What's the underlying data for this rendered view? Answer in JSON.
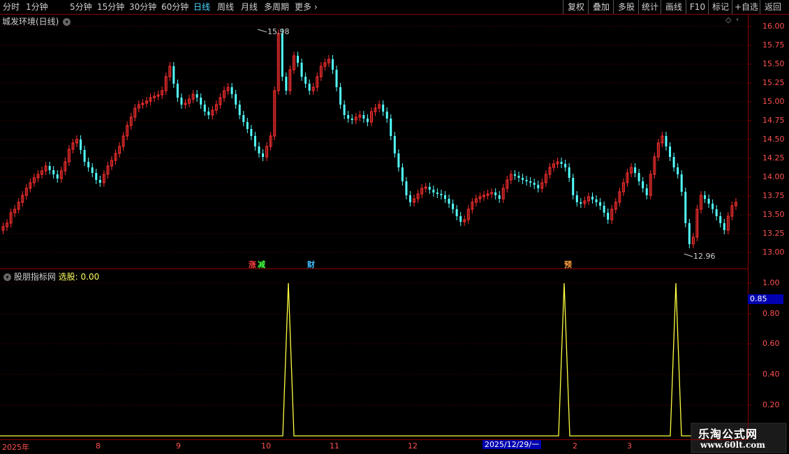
{
  "toolbar": {
    "periods": [
      "分时",
      "1分钟",
      "5分钟",
      "15分钟",
      "30分钟",
      "60分钟",
      "日线",
      "周线",
      "月线",
      "多周期",
      "更多"
    ],
    "active_period": "日线",
    "right_buttons": [
      "复权",
      "叠加",
      "多股",
      "统计",
      "画线",
      "F10",
      "标记",
      "+自选",
      "返回"
    ]
  },
  "main_chart": {
    "title": "城发环境(日线)",
    "price_axis": [
      "16.00",
      "15.75",
      "15.50",
      "15.25",
      "15.00",
      "14.75",
      "14.50",
      "14.25",
      "14.00",
      "13.75",
      "13.50",
      "13.25",
      "13.00"
    ],
    "high_label": "15.98",
    "low_label": "12.96",
    "signals": [
      {
        "text": "涨",
        "color": "#ff4040"
      },
      {
        "text": "减",
        "color": "#40ff40"
      },
      {
        "text": "财",
        "color": "#40c0ff"
      },
      {
        "text": "预",
        "color": "#ffa040"
      }
    ],
    "up_color": "#ff3030",
    "down_color": "#54ffff"
  },
  "indicator": {
    "title": "股朋指标网",
    "label": "选股:",
    "value": "0.00",
    "current_value": "0.85",
    "axis": [
      "1.00",
      "0.80",
      "0.60",
      "0.40",
      "0.20"
    ],
    "line_color": "#ffff40",
    "spike_values": [
      0,
      0,
      1,
      0,
      0,
      1,
      0,
      1,
      0
    ]
  },
  "x_axis": {
    "labels": [
      "2025年",
      "8",
      "9",
      "10",
      "11",
      "12",
      "2",
      "3"
    ],
    "cursor_date": "2025/12/29/一"
  },
  "watermark": {
    "cn": "乐淘公式网",
    "url": "www.60lt.com"
  }
}
